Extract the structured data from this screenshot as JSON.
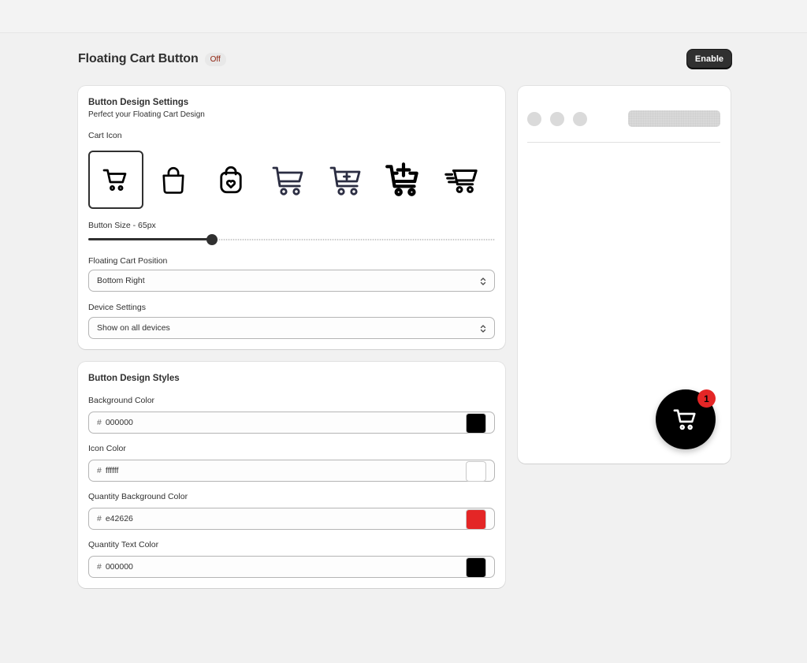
{
  "header": {
    "title": "Floating Cart Button",
    "status_badge": "Off",
    "enable_label": "Enable"
  },
  "design_settings": {
    "title": "Button Design Settings",
    "subtitle": "Perfect your Floating Cart Design",
    "cart_icon_label": "Cart Icon",
    "cart_icons": [
      {
        "icon": "cart-icon",
        "selected": true
      },
      {
        "icon": "shopping-bag-icon",
        "selected": false
      },
      {
        "icon": "heart-bag-icon",
        "selected": false
      },
      {
        "icon": "cart-outline-icon",
        "selected": false
      },
      {
        "icon": "cart-plus-icon",
        "selected": false
      },
      {
        "icon": "cart-add-bold-icon",
        "selected": false
      },
      {
        "icon": "fast-cart-icon",
        "selected": false
      }
    ],
    "button_size_label": "Button Size - 65px",
    "button_size_fraction": 0.305,
    "position_label": "Floating Cart Position",
    "position_value": "Bottom Right",
    "device_label": "Device Settings",
    "device_value": "Show on all devices"
  },
  "design_styles": {
    "title": "Button Design Styles",
    "hash": "#",
    "background_color": {
      "label": "Background Color",
      "value": "000000",
      "swatch": "#000000"
    },
    "icon_color": {
      "label": "Icon Color",
      "value": "ffffff",
      "swatch": "#ffffff"
    },
    "quantity_bg_color": {
      "label": "Quantity Background Color",
      "value": "e42626",
      "swatch": "#e42626"
    },
    "quantity_text_color": {
      "label": "Quantity Text Color",
      "value": "000000",
      "swatch": "#000000"
    }
  },
  "preview": {
    "quantity": "1"
  }
}
